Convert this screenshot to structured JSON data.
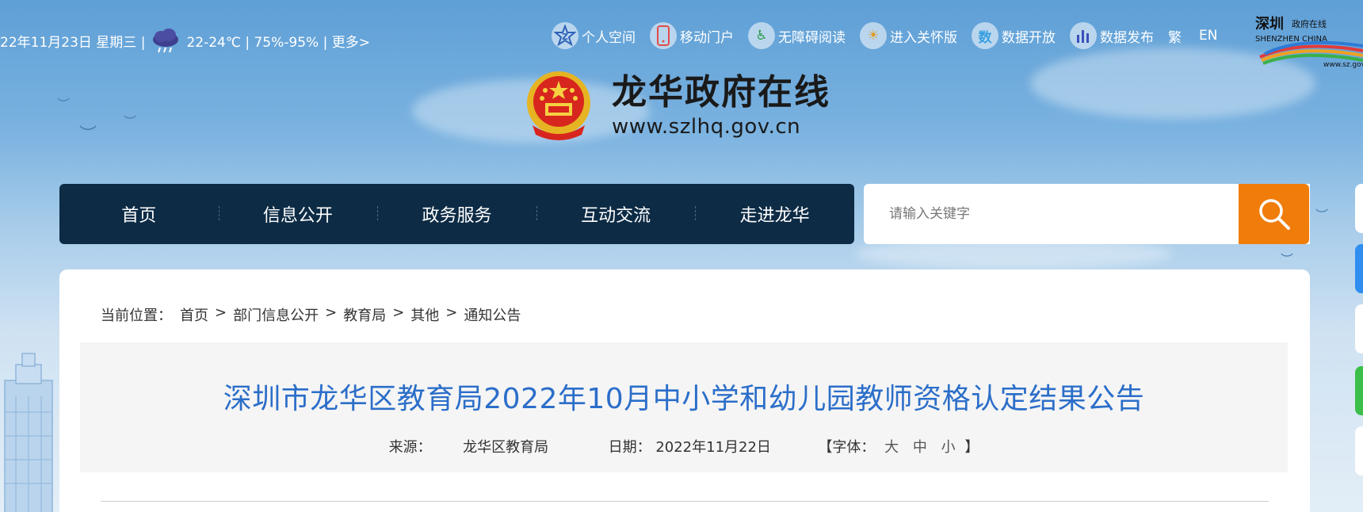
{
  "weather": {
    "date_text": "22年11月23日 星期三 |",
    "temp_text": "22-24℃ | 75%-95% | 更多>"
  },
  "quick_links": [
    {
      "label": "个人空间",
      "icon": "person-icon",
      "glyph": "Z"
    },
    {
      "label": "移动门户",
      "icon": "mobile-icon",
      "glyph": "▯"
    },
    {
      "label": "无障碍阅读",
      "icon": "accessibility-icon",
      "glyph": "♿"
    },
    {
      "label": "进入关怀版",
      "icon": "care-icon",
      "glyph": "☀"
    },
    {
      "label": "数据开放",
      "icon": "data-open-icon",
      "glyph": "数"
    },
    {
      "label": "数据发布",
      "icon": "data-chart-icon",
      "glyph": "▮"
    }
  ],
  "lang": {
    "traditional": "繁",
    "english": "EN"
  },
  "sz_logo": {
    "line1": "深圳",
    "line2": "政府在线",
    "line3": "SHENZHEN CHINA",
    "url": "www.sz.gov"
  },
  "site": {
    "title": "龙华政府在线",
    "url": "www.szlhq.gov.cn"
  },
  "nav": [
    "首页",
    "信息公开",
    "政务服务",
    "互动交流",
    "走进龙华"
  ],
  "search": {
    "placeholder": "请输入关键字"
  },
  "breadcrumb": {
    "prefix": "当前位置：",
    "items": [
      "首页",
      "部门信息公开",
      "教育局",
      "其他",
      "通知公告"
    ],
    "sep": ">"
  },
  "article": {
    "title": "深圳市龙华区教育局2022年10月中小学和幼儿园教师资格认定结果公告",
    "source_label": "来源：",
    "source": "龙华区教育局",
    "date_label": "日期：",
    "date": "2022年11月22日",
    "font_open": "【字体：",
    "font_large": "大",
    "font_medium": "中",
    "font_small": "小",
    "font_close": "】"
  },
  "colors": {
    "nav_bg": "#0d2b45",
    "search_btn": "#f07c0a",
    "title_blue": "#2b6ec9"
  }
}
